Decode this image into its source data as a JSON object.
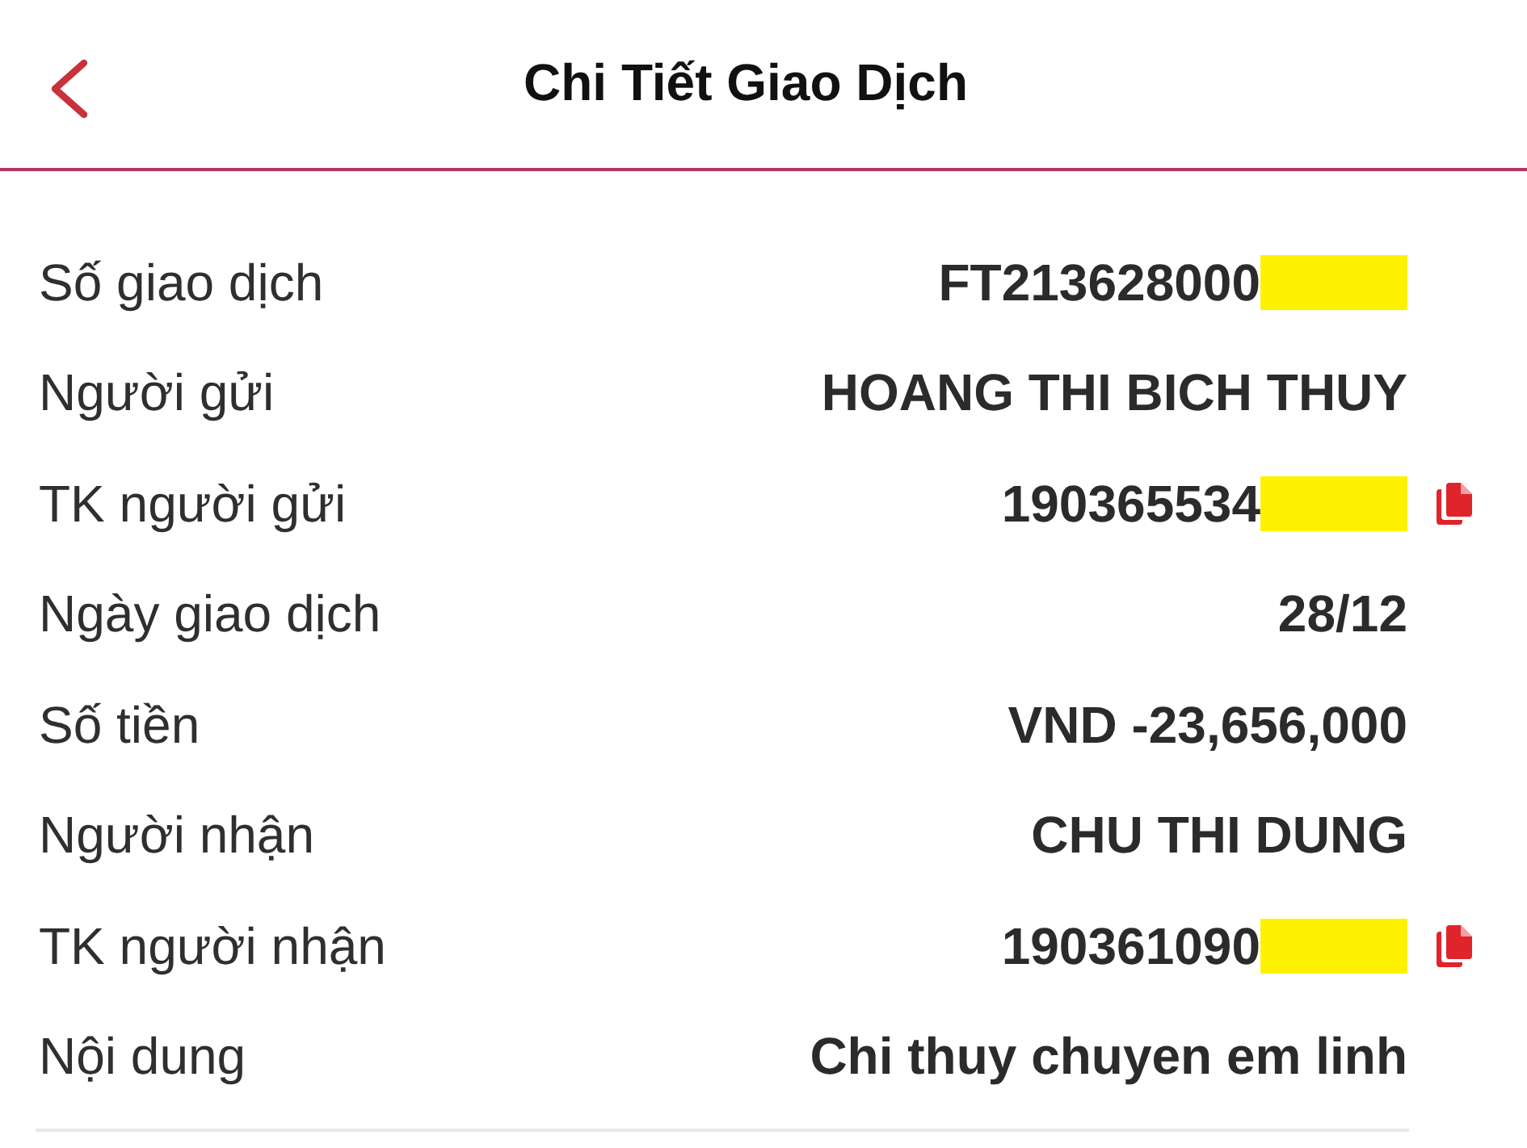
{
  "header": {
    "title": "Chi Tiết Giao Dịch"
  },
  "details": [
    {
      "label": "Số giao dịch",
      "value": "FT213628000",
      "redacted": true,
      "copyable": false
    },
    {
      "label": "Người gửi",
      "value": "HOANG THI BICH THUY",
      "redacted": false,
      "copyable": false
    },
    {
      "label": "TK người gửi",
      "value": "190365534",
      "redacted": true,
      "copyable": true
    },
    {
      "label": "Ngày giao dịch",
      "value": "28/12",
      "redacted": false,
      "copyable": false
    },
    {
      "label": "Số tiền",
      "value": "VND -23,656,000",
      "redacted": false,
      "copyable": false
    },
    {
      "label": "Người nhận",
      "value": "CHU THI DUNG",
      "redacted": false,
      "copyable": false
    },
    {
      "label": "TK người nhận",
      "value": "190361090",
      "redacted": true,
      "copyable": true
    },
    {
      "label": "Nội dung",
      "value": "Chi thuy chuyen em linh",
      "redacted": false,
      "copyable": false
    }
  ]
}
